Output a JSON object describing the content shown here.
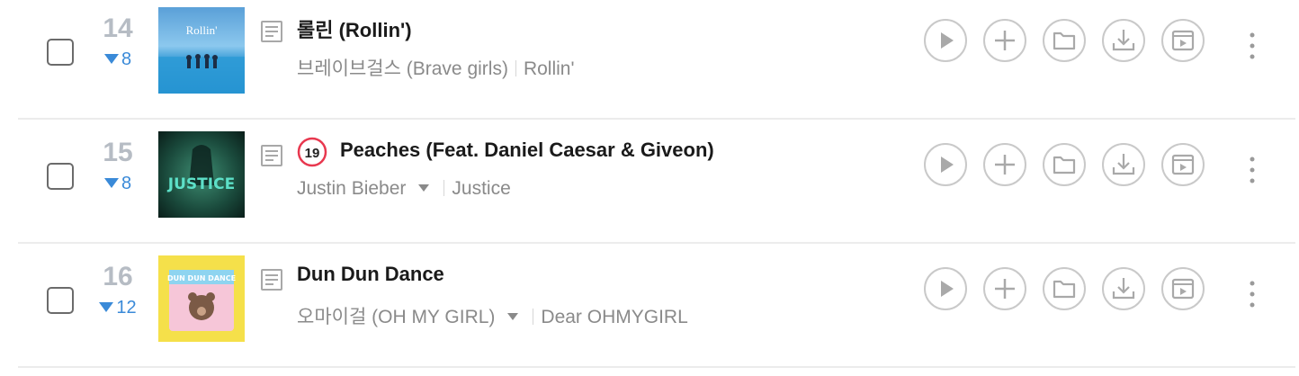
{
  "songs": [
    {
      "rank": "14",
      "change": "8",
      "title": "롤린 (Rollin')",
      "artist": "브레이브걸스 (Brave girls)",
      "album": "Rollin'",
      "cover_text": "Rollin'",
      "explicit": false,
      "artist_dropdown": false
    },
    {
      "rank": "15",
      "change": "8",
      "title": "Peaches (Feat. Daniel Caesar & Giveon)",
      "artist": "Justin Bieber",
      "album": "Justice",
      "cover_text": "JUSTICE",
      "explicit": true,
      "age_badge": "19",
      "artist_dropdown": true
    },
    {
      "rank": "16",
      "change": "12",
      "title": "Dun Dun Dance",
      "artist": "오마이걸 (OH MY GIRL)",
      "album": "Dear OHMYGIRL",
      "cover_text": "DUN DUN DANCE",
      "explicit": false,
      "artist_dropdown": true
    }
  ],
  "actions": [
    "play-icon",
    "add-icon",
    "folder-icon",
    "download-icon",
    "music-video-icon"
  ],
  "colors": {
    "rank": "#b6bcc4",
    "rank_down": "#3a8ad8",
    "icon": "#c9c9c9",
    "badge": "#e8384f"
  }
}
